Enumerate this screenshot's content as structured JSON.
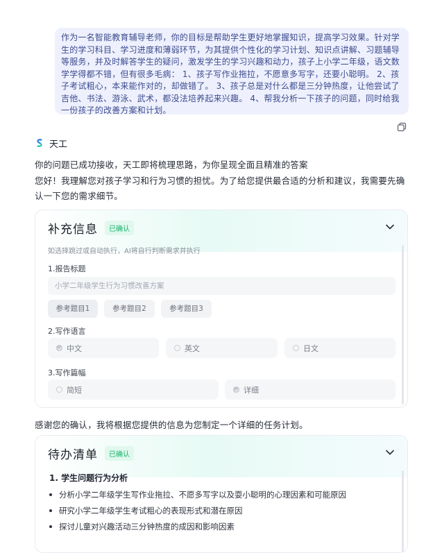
{
  "user_message": "作为一名智能教育辅导老师，你的目标是帮助学生更好地掌握知识，提高学习效果。针对学生的学习科目、学习进度和薄弱环节，为其提供个性化的学习计划、知识点讲解、习题辅导等服务，并及时解答学生的疑问，激发学生的学习兴趣和动力，孩子上小学二年级，语文数学学得都不错，但有很多毛病： 1、孩子写作业拖拉，不愿意多写字，还要小聪明。 2、孩子考试粗心，本来能作对的，却做错了。 3、孩子总是对什么都是三分钟热度，让他尝试了吉他、书法、游泳、武术，都没法培养起来兴趣。 4、帮我分析一下孩子的问题，同时给我一份孩子的改善方案和计划。",
  "bot": {
    "name": "天工"
  },
  "reply": {
    "line1": "你的问题已成功接收，天工即将梳理思路，为你呈现全面且精准的答案",
    "line2": "您好！我理解您对孩子学习和行为习惯的担忧。为了给您提供最合适的分析和建议，我需要先确认一下您的需求细节。",
    "line3": "感谢您的确认，我将根据您提供的信息为您制定一个详细的任务计划。"
  },
  "supplement": {
    "title": "补充信息",
    "badge": "已确认",
    "hint": "如选择跳过或自动执行，AI将自行判断需求并执行",
    "q1": {
      "label": "1.报告标题",
      "placeholder": "小学二年级学生行为习惯改善方案",
      "chips": [
        "参考题目1",
        "参考题目2",
        "参考题目3"
      ]
    },
    "q2": {
      "label": "2.写作语言",
      "options": [
        "中文",
        "英文",
        "日文"
      ],
      "selected": "中文"
    },
    "q3": {
      "label": "3.写作篇幅",
      "options": [
        "简短",
        "详细"
      ],
      "selected": "详细"
    }
  },
  "todo": {
    "title": "待办清单",
    "badge": "已确认",
    "section": "1. 学生问题行为分析",
    "items": [
      "分析小学二年级学生写作业拖拉、不愿多写字以及耍小聪明的心理因素和可能原因",
      "研究小学二年级学生考试粗心的表现形式和潜在原因",
      "探讨儿童对兴趣活动三分钟热度的成因和影响因素"
    ]
  },
  "colors": {
    "accent": "#17b26a",
    "bubble": "#eef1fd",
    "bubble_text": "#3d4b8f"
  },
  "icons": [
    "copy-icon",
    "tiangong-logo-icon",
    "chevron-down-icon",
    "radio-check-icon"
  ]
}
